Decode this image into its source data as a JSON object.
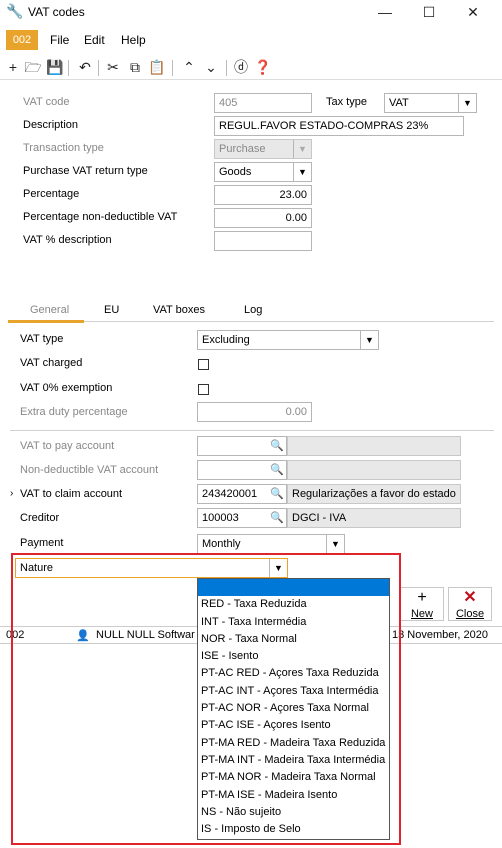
{
  "window": {
    "title": "VAT codes"
  },
  "menubar": {
    "code": "002",
    "file": "File",
    "edit": "Edit",
    "help": "Help"
  },
  "form": {
    "vat_code_label": "VAT code",
    "vat_code_value": "405",
    "tax_type_label": "Tax type",
    "tax_type_value": "VAT",
    "description_label": "Description",
    "description_value": "REGUL.FAVOR ESTADO-COMPRAS 23%",
    "transaction_type_label": "Transaction type",
    "transaction_type_value": "Purchase",
    "purchase_vat_return_type_label": "Purchase VAT return type",
    "purchase_vat_return_type_value": "Goods",
    "percentage_label": "Percentage",
    "percentage_value": "23.00",
    "percentage_nondeductible_label": "Percentage non-deductible VAT",
    "percentage_nondeductible_value": "0.00",
    "vat_percent_description_label": "VAT % description",
    "vat_percent_description_value": ""
  },
  "tabs": [
    "General",
    "EU",
    "VAT boxes",
    "Log"
  ],
  "general": {
    "vat_type_label": "VAT type",
    "vat_type_value": "Excluding",
    "vat_charged_label": "VAT charged",
    "vat_0_exemption_label": "VAT 0% exemption",
    "extra_duty_label": "Extra duty percentage",
    "extra_duty_value": "0.00",
    "vat_to_pay_account_label": "VAT to pay account",
    "nondeductible_vat_account_label": "Non-deductible VAT account",
    "vat_to_claim_account_label": "VAT to claim account",
    "vat_to_claim_account_code": "243420001",
    "vat_to_claim_account_name": "Regularizações a favor do estado",
    "creditor_label": "Creditor",
    "creditor_code": "100003",
    "creditor_name": "DGCI - IVA",
    "payment_label": "Payment",
    "payment_value": "Monthly",
    "nature_label": "Nature"
  },
  "buttons": {
    "new": "New",
    "close": "Close"
  },
  "statusbar": {
    "code": "002",
    "user": "NULL NULL Softwar",
    "date": "13 November, 2020"
  },
  "nature_options": [
    "",
    "RED - Taxa Reduzida",
    "INT - Taxa Intermédia",
    "NOR - Taxa Normal",
    "ISE - Isento",
    "PT-AC RED - Açores Taxa Reduzida",
    "PT-AC INT - Açores Taxa Intermédia",
    "PT-AC NOR - Açores Taxa Normal",
    "PT-AC ISE - Açores Isento",
    "PT-MA RED - Madeira Taxa Reduzida",
    "PT-MA INT - Madeira Taxa Intermédia",
    "PT-MA NOR - Madeira Taxa Normal",
    "PT-MA ISE - Madeira Isento",
    "NS - Não sujeito",
    "IS - Imposto de Selo"
  ],
  "colors": {
    "accent": "#e8a32b",
    "selection": "#0078d7",
    "highlight": "#e0242e"
  }
}
